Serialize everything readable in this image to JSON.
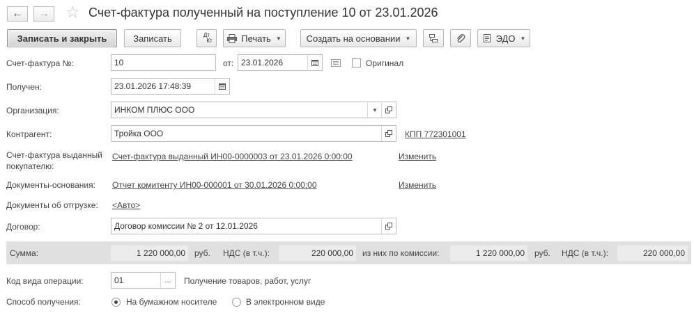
{
  "window": {
    "title": "Счет-фактура полученный на поступление 10 от 23.01.2026"
  },
  "nav": {
    "back_icon": "←",
    "forward_icon": "→",
    "favorite_icon": "☆"
  },
  "toolbar": {
    "save_close": "Записать и закрыть",
    "save": "Записать",
    "dtkt_top": "Дт",
    "dtkt_bottom": "Кт",
    "print": "Печать",
    "create_based": "Создать на основании",
    "edo": "ЭДО"
  },
  "form": {
    "invoice_no": {
      "label": "Счет-фактура №:",
      "value": "10",
      "date_label": "от:",
      "date": "23.01.2026",
      "original_label": "Оригинал"
    },
    "received": {
      "label": "Получен:",
      "value": "23.01.2026 17:48:39"
    },
    "organization": {
      "label": "Организация:",
      "value": "ИНКОМ ПЛЮС ООО"
    },
    "counterparty": {
      "label": "Контрагент:",
      "value": "Тройка ООО",
      "kpp": "КПП 772301001"
    },
    "issued_invoice": {
      "label_line1": "Счет-фактура выданный",
      "label_line2": "покупателю:",
      "value": "Счет-фактура выданный ИН00-0000003 от 23.01.2026 0:00:00",
      "action": "Изменить"
    },
    "base_docs": {
      "label": "Документы-основания:",
      "value": "Отчет комитенту ИН00-000001 от 30.01.2026 0:00:00",
      "action": "Изменить"
    },
    "shipment_docs": {
      "label": "Документы об отгрузке:",
      "value": "<Авто>"
    },
    "contract": {
      "label": "Договор:",
      "value": "Договор комиссии № 2 от 12.01.2026"
    },
    "operation_code": {
      "label": "Код вида операции:",
      "value": "01",
      "select": "...",
      "description": "Получение товаров, работ, услуг"
    },
    "receipt_method": {
      "label": "Способ получения:",
      "options": [
        "На бумажном носителе",
        "В электронном виде"
      ],
      "selected": 0
    }
  },
  "totals": {
    "sum_label": "Сумма:",
    "sum": "1 220 000,00",
    "currency": "руб.",
    "vat_label": "НДС (в т.ч.):",
    "vat": "220 000,00",
    "commission_label": "из них по комиссии:",
    "commission_sum": "1 220 000,00",
    "currency2": "руб.",
    "vat_label2": "НДС (в т.ч.):",
    "commission_vat": "220 000,00"
  }
}
